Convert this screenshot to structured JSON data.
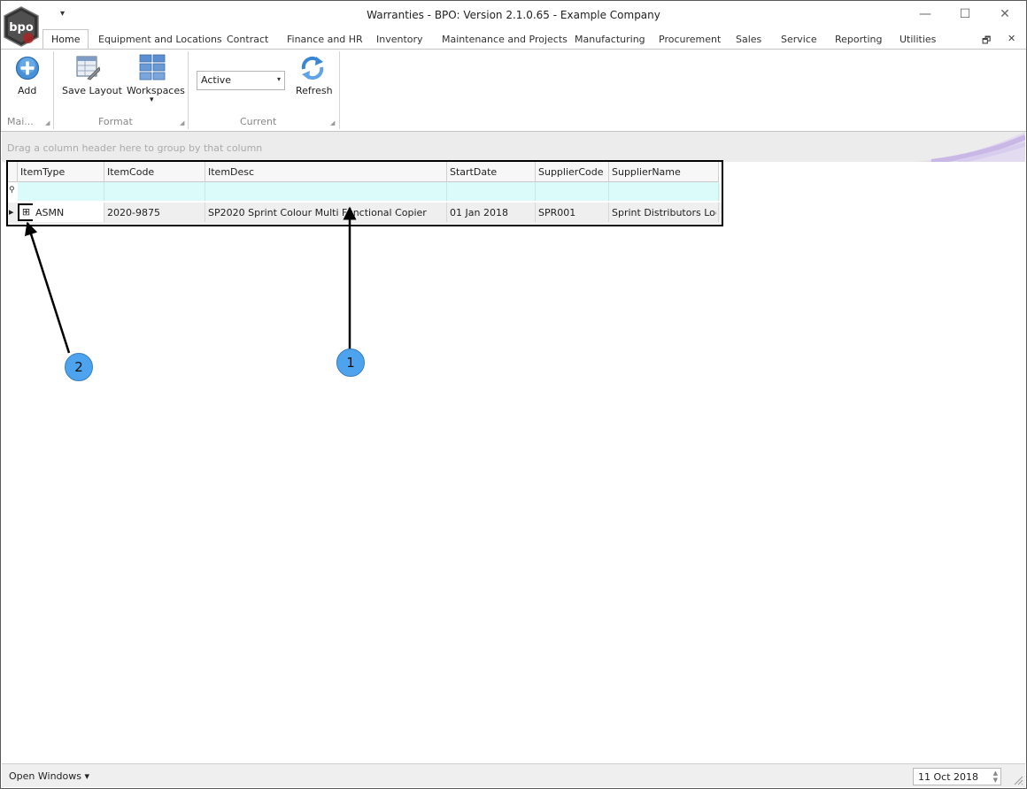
{
  "window": {
    "title": "Warranties - BPO: Version 2.1.0.65 - Example Company",
    "quick_access_glyph": "▾",
    "controls": {
      "minimize": "—",
      "maximize": "☐",
      "close": "✕"
    }
  },
  "tabs": [
    {
      "label": "Home",
      "active": true
    },
    {
      "label": "Equipment and Locations"
    },
    {
      "label": "Contract"
    },
    {
      "label": "Finance and HR"
    },
    {
      "label": "Inventory"
    },
    {
      "label": "Maintenance and Projects"
    },
    {
      "label": "Manufacturing"
    },
    {
      "label": "Procurement"
    },
    {
      "label": "Sales"
    },
    {
      "label": "Service"
    },
    {
      "label": "Reporting"
    },
    {
      "label": "Utilities"
    }
  ],
  "mdi": {
    "restore": "🗗",
    "close": "✕"
  },
  "ribbon": {
    "maintain": {
      "label": "Mai...",
      "add": {
        "label": "Add",
        "icon": "add-icon"
      }
    },
    "format": {
      "label": "Format",
      "save_layout": {
        "label": "Save Layout",
        "icon": "save-layout-icon"
      },
      "workspaces": {
        "label": "Workspaces",
        "icon": "workspaces-icon",
        "arrow": "▾"
      }
    },
    "current": {
      "label": "Current",
      "status_combo": {
        "value": "Active",
        "arrow": "▾"
      },
      "refresh": {
        "label": "Refresh",
        "icon": "refresh-icon"
      }
    }
  },
  "grid": {
    "group_hint": "Drag a column header here to group by that column",
    "columns": [
      "ItemType",
      "ItemCode",
      "ItemDesc",
      "StartDate",
      "SupplierCode",
      "SupplierName"
    ],
    "filter_glyph": "⚲",
    "rows": [
      {
        "expander": "⊞",
        "indicator": "▸",
        "cells": [
          "ASMN",
          "2020-9875",
          "SP2020 Sprint Colour Multi Functional Copier",
          "01 Jan 2018",
          "SPR001",
          "Sprint Distributors Local"
        ]
      }
    ]
  },
  "callouts": [
    "1",
    "2"
  ],
  "status": {
    "open_windows": "Open Windows ▾",
    "date": "11 Oct 2018"
  },
  "colors": {
    "accent": "#4da3ee",
    "filter_row": "#dbfafa",
    "highlight_border": "#000000"
  }
}
